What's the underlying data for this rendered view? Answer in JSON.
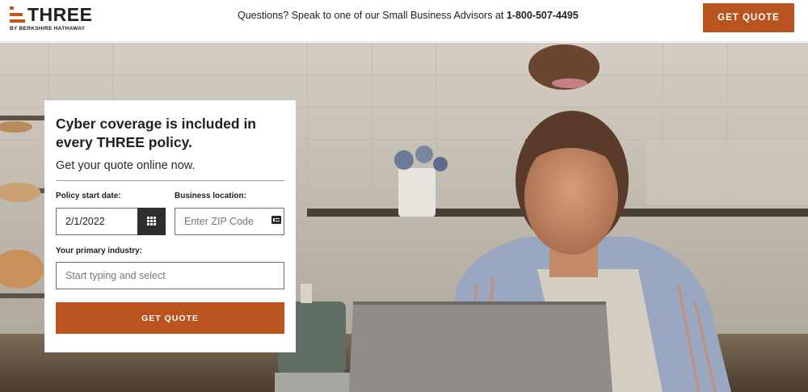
{
  "brand": {
    "name": "THREE",
    "tagline": "BY BERKSHIRE HATHAWAY",
    "accent_color": "#b9531f"
  },
  "header": {
    "questions_text": "Questions? Speak to one of our Small Business Advisors at ",
    "phone": "1-800-507-4495",
    "cta_label": "GET QUOTE"
  },
  "quote_form": {
    "title": "Cyber coverage is included in every THREE policy.",
    "subtitle": "Get your quote online now.",
    "start_date_label": "Policy start date:",
    "start_date_value": "2/1/2022",
    "location_label": "Business location:",
    "zip_placeholder": "Enter ZIP Code",
    "industry_label": "Your primary industry:",
    "industry_placeholder": "Start typing and select",
    "submit_label": "GET QUOTE",
    "icons": [
      "calendar-icon",
      "id-card-icon"
    ]
  }
}
